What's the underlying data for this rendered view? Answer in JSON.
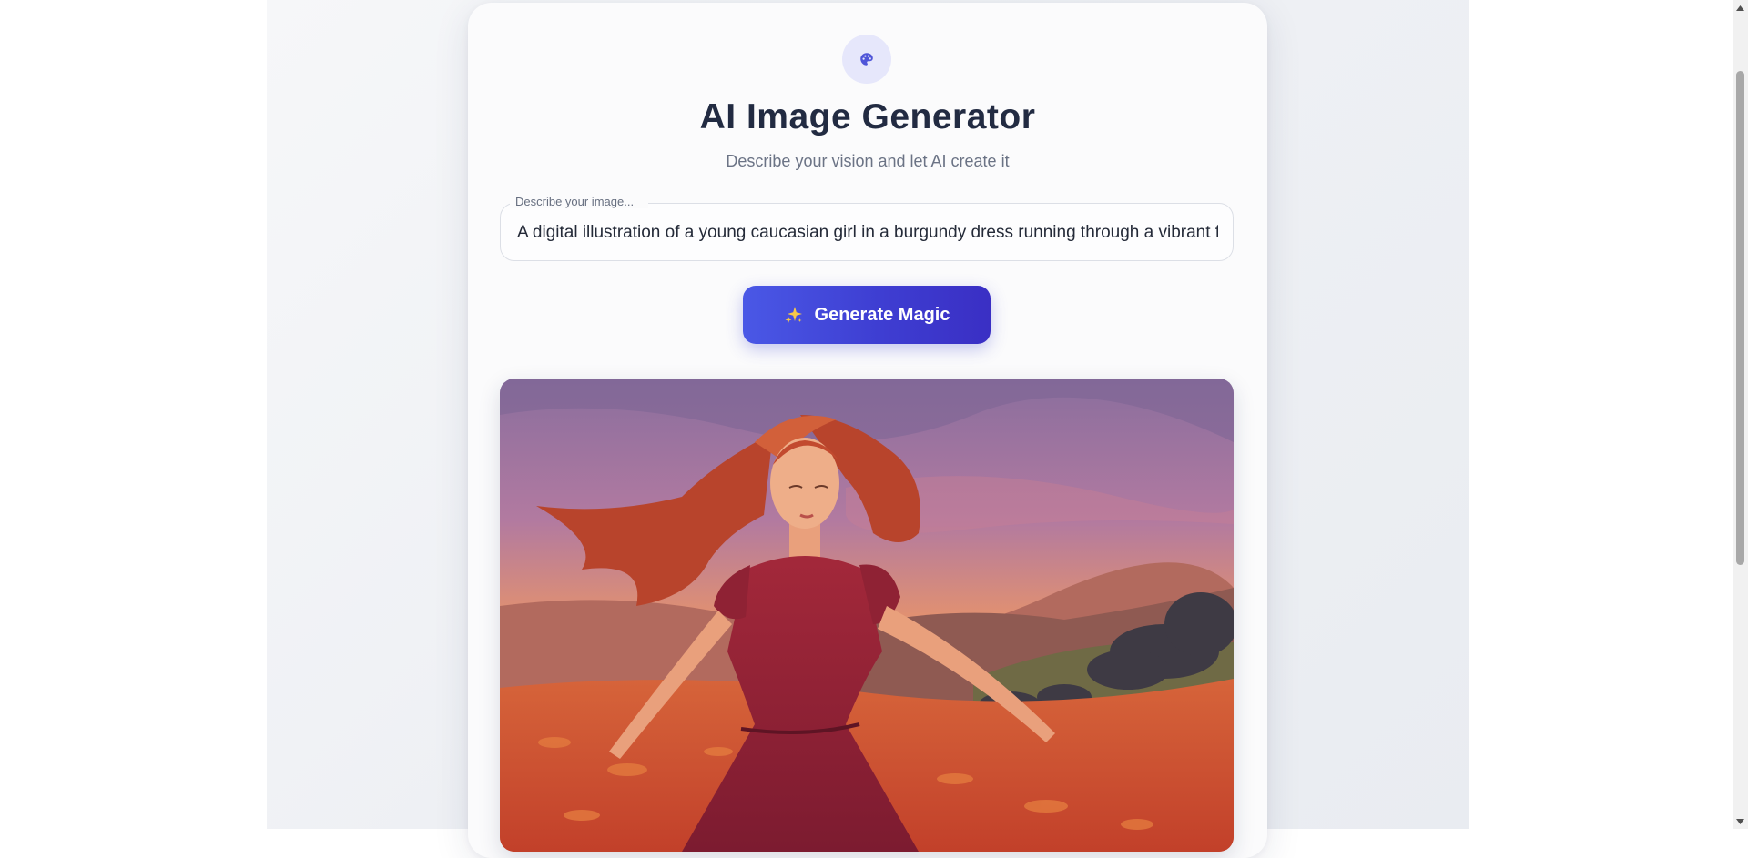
{
  "header": {
    "logo_icon": "palette-icon",
    "title": "AI Image Generator",
    "subtitle": "Describe your vision and let AI create it"
  },
  "prompt": {
    "label": "Describe your image...",
    "value": "A digital illustration of a young caucasian girl in a burgundy dress running through a vibrant field at sunset"
  },
  "generate_button": {
    "icon": "sparkles-icon",
    "label": "Generate Magic"
  },
  "result": {
    "image_description_icon": "generated-image"
  },
  "colors": {
    "accent": "#4a4fe0",
    "title": "#222b42",
    "subtitle": "#6b7385"
  }
}
